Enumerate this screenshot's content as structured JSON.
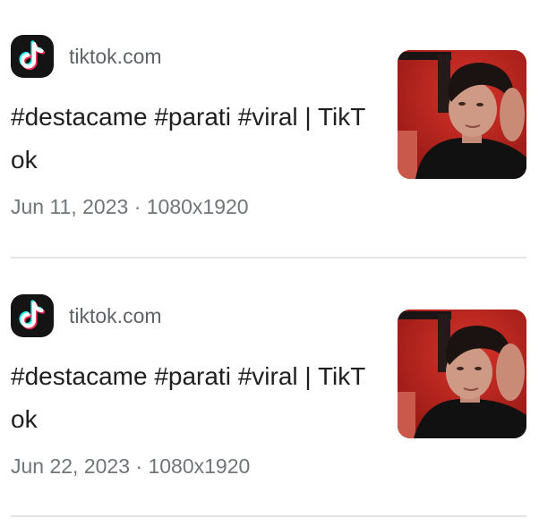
{
  "results": [
    {
      "favicon_icon": "tiktok-logo-icon",
      "source": "tiktok.com",
      "title": "#destacame #parati #viral | TikTok",
      "date": "Jun 11, 2023",
      "separator": "·",
      "dimensions": "1080x1920",
      "thumbnail": "video-thumbnail-portrait"
    },
    {
      "favicon_icon": "tiktok-logo-icon",
      "source": "tiktok.com",
      "title": "#destacame #parati #viral | TikTok",
      "date": "Jun 22, 2023",
      "separator": "·",
      "dimensions": "1080x1920",
      "thumbnail": "video-thumbnail-portrait"
    }
  ],
  "colors": {
    "title_text": "#1f1f1f",
    "secondary_text": "#5f6368",
    "divider": "#e4e4e4",
    "tiktok_cyan": "#25f4ee",
    "tiktok_red": "#fe2c55"
  }
}
